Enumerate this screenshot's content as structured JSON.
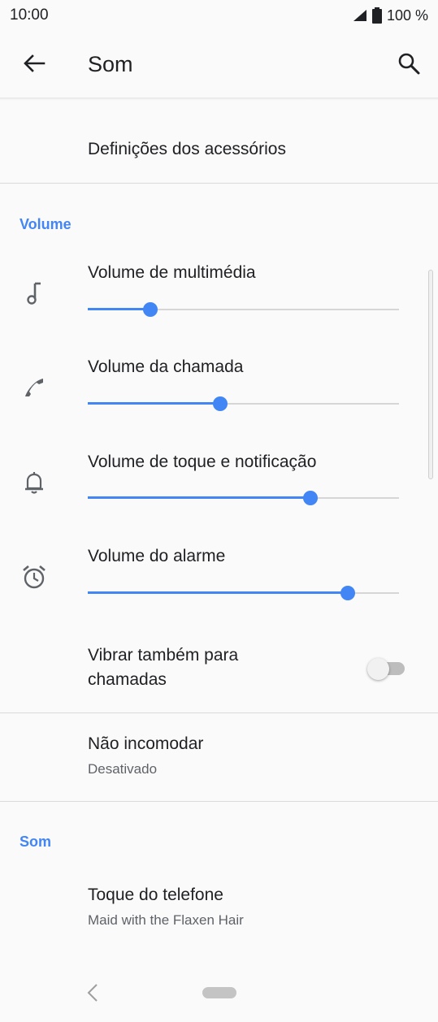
{
  "status_bar": {
    "time": "10:00",
    "battery": "100 %"
  },
  "app_bar": {
    "title": "Som"
  },
  "items": {
    "accessories": "Definições dos acessórios",
    "volume_header": "Volume",
    "media_volume": {
      "label": "Volume de multimédia",
      "level": 0.2
    },
    "call_volume": {
      "label": "Volume da chamada",
      "level": 0.425
    },
    "ring_volume": {
      "label": "Volume de toque e notificação",
      "level": 0.715
    },
    "alarm_volume": {
      "label": "Volume do alarme",
      "level": 0.835
    },
    "vibrate_calls": {
      "label_line1": "Vibrar também para",
      "label_line2": "chamadas",
      "enabled": false
    },
    "dnd": {
      "label": "Não incomodar",
      "value": "Desativado"
    },
    "sound_header": "Som",
    "ringtone": {
      "label": "Toque do telefone",
      "value": "Maid with the Flaxen Hair"
    }
  },
  "colors": {
    "accent": "#4285f4",
    "text": "#202124",
    "secondary": "#5f6368"
  }
}
